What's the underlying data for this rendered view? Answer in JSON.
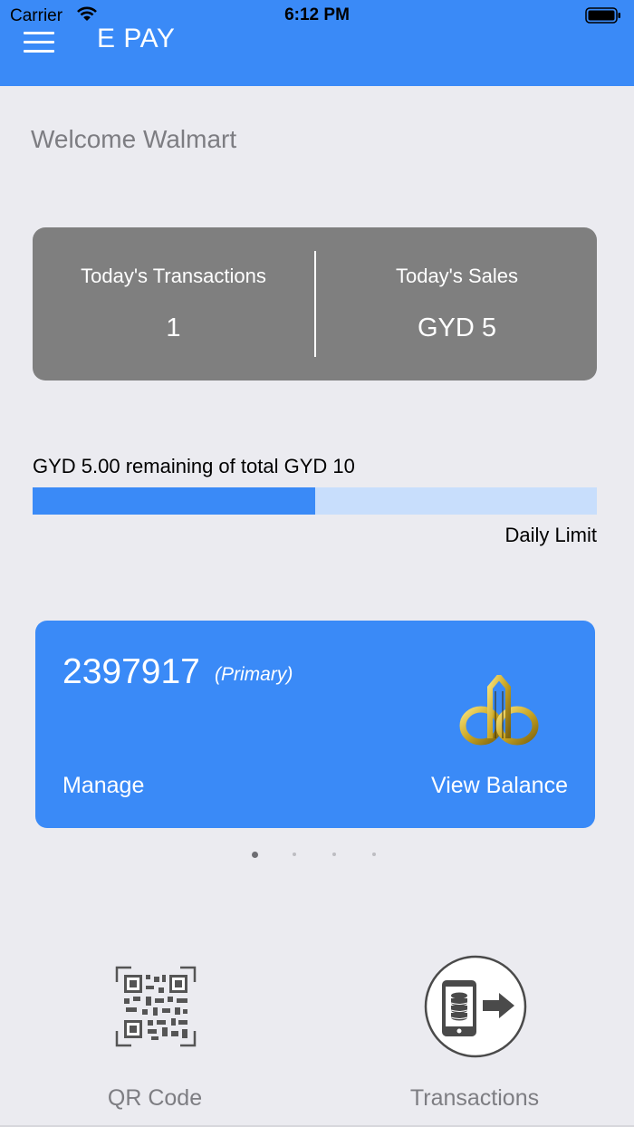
{
  "status_bar": {
    "carrier": "Carrier",
    "time": "6:12 PM"
  },
  "header": {
    "title": "E PAY",
    "menu_icon": "hamburger-menu-icon",
    "background_color": "#3a8af7"
  },
  "welcome": "Welcome Walmart",
  "summary": {
    "transactions_label": "Today's Transactions",
    "transactions_value": "1",
    "sales_label": "Today's Sales",
    "sales_value": "GYD 5",
    "card_color": "#7f7f7f"
  },
  "daily_limit": {
    "text": "GYD 5.00 remaining of total GYD 10",
    "label": "Daily Limit",
    "progress_fraction": 0.5,
    "fill_color": "#3a8af7",
    "track_color": "#c8defc"
  },
  "account_card": {
    "account_number": "2397917",
    "tag": "(Primary)",
    "manage_label": "Manage",
    "view_balance_label": "View Balance",
    "logo_icon": "bank-logo-icon"
  },
  "pager": {
    "count": 4,
    "active_index": 0
  },
  "actions": [
    {
      "label": "QR Code",
      "icon": "qr-code-icon"
    },
    {
      "label": "Transactions",
      "icon": "phone-transfer-icon"
    }
  ]
}
